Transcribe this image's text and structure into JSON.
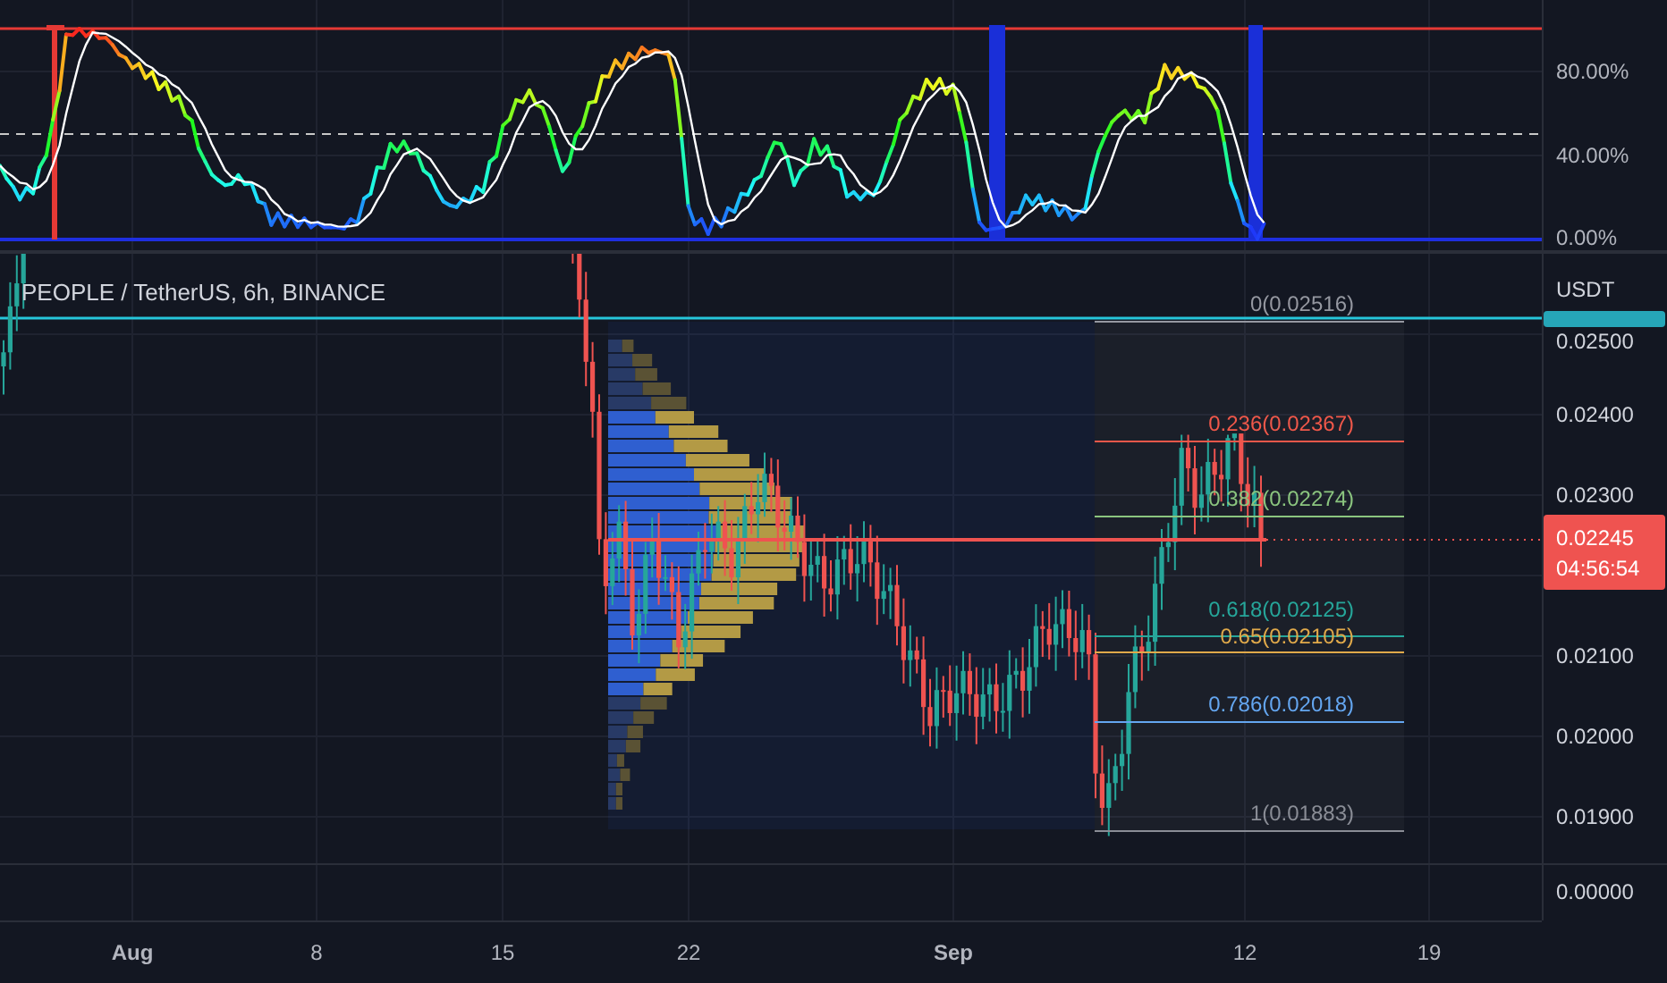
{
  "indicator_pane": {
    "axis_labels": [
      "80.00%",
      "40.00%",
      "0.00%"
    ]
  },
  "price_pane": {
    "title": "PEOPLE / TetherUS, 6h, BINANCE",
    "currency": "USDT",
    "axis_labels": [
      "0.02500",
      "0.02400",
      "0.02300",
      "0.02100",
      "0.02000",
      "0.01900"
    ],
    "last_price": "0.02245",
    "countdown": "04:56:54",
    "fib_levels": [
      {
        "label": "0(0.02516)",
        "color": "#9598a1"
      },
      {
        "label": "0.236(0.02367)",
        "color": "#f0584a"
      },
      {
        "label": "0.382(0.02274)",
        "color": "#8bc57f"
      },
      {
        "label": "0.618(0.02125)",
        "color": "#26a69a"
      },
      {
        "label": "0.65(0.02105)",
        "color": "#e0a94a"
      },
      {
        "label": "0.786(0.02018)",
        "color": "#64a6f0"
      },
      {
        "label": "1(0.01883)",
        "color": "#8a8d96"
      }
    ]
  },
  "lower_pane": {
    "axis_labels": [
      "0.00000"
    ]
  },
  "time_axis": {
    "labels": [
      {
        "text": "Aug",
        "kind": "month"
      },
      {
        "text": "8",
        "kind": "day"
      },
      {
        "text": "15",
        "kind": "day"
      },
      {
        "text": "22",
        "kind": "day"
      },
      {
        "text": "Sep",
        "kind": "month"
      },
      {
        "text": "12",
        "kind": "day"
      },
      {
        "text": "19",
        "kind": "day"
      }
    ]
  }
}
